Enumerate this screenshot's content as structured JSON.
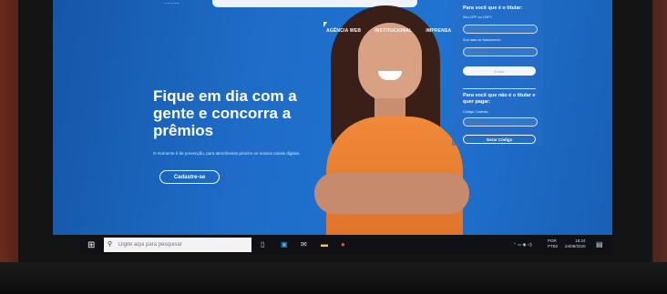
{
  "website": {
    "logo_text": "..........",
    "nav": [
      "AGÊNCIA WEB",
      "INSTITUCIONAL",
      "IMPRENSA"
    ],
    "hero": {
      "title": "Fique em dia com a\ngente e concorra a\nprêmios",
      "subtitle": "O momento é de prevenção, para atendimento priorize os nossos canais digitais.",
      "cta": "Cadastre-se"
    },
    "form": {
      "holder_title": "Para você que é o titular:",
      "cpf_label": "Seu CPF ou CNPJ",
      "cpf_placeholder": "Digite aqui",
      "birth_label": "Sua data de Nascimento",
      "birth_placeholder": "dd/mm/aaaa",
      "enter_button": "Entrar",
      "non_holder_title": "Para você que não é o titular e quer pagar:",
      "code_label": "Código Contrato",
      "code_placeholder": "Digite aqui",
      "generate_button": "Gerar Código"
    }
  },
  "taskbar": {
    "search_placeholder": "Digite aqui para pesquisar",
    "lang_top": "POR",
    "lang_bottom": "PTB2",
    "time": "18:24",
    "date": "24/08/2020"
  },
  "colors": {
    "site_bg": "#1e6cc7",
    "shirt": "#f08a3a",
    "taskbar": "#0f1114"
  }
}
